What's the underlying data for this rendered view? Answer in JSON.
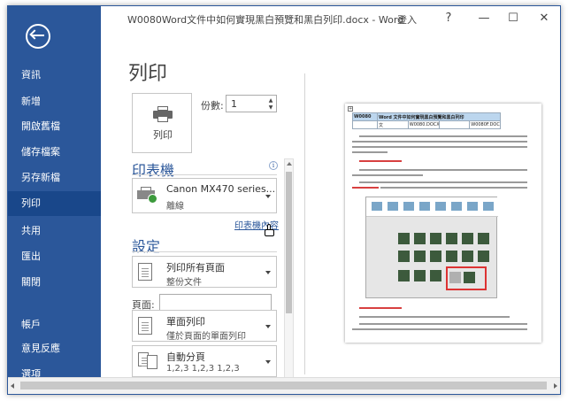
{
  "window": {
    "title": "W0080Word文件中如何實現黑白預覽和黑白列印.docx - Word",
    "login": "登入",
    "help": "?",
    "minimize": "—",
    "maximize": "☐",
    "close": "✕"
  },
  "sidebar": {
    "items": [
      {
        "label": "資訊"
      },
      {
        "label": "新增"
      },
      {
        "label": "開啟舊檔"
      },
      {
        "label": "儲存檔案"
      },
      {
        "label": "另存新檔"
      },
      {
        "label": "列印",
        "active": true
      },
      {
        "label": "共用"
      },
      {
        "label": "匯出"
      },
      {
        "label": "關閉"
      },
      {
        "label": "帳戶"
      },
      {
        "label": "意見反應"
      },
      {
        "label": "選項"
      }
    ]
  },
  "print": {
    "heading": "列印",
    "button_label": "列印",
    "copies_label": "份數:",
    "copies_value": "1"
  },
  "printer": {
    "section_title": "印表機",
    "name": "Canon MX470 series...",
    "status": "離線",
    "properties_link": "印表機內容"
  },
  "settings": {
    "section_title": "設定",
    "scope_main": "列印所有頁面",
    "scope_sub": "整份文件",
    "pages_label": "頁面:",
    "pages_value": "",
    "sides_main": "單面列印",
    "sides_sub": "僅於頁面的單面列印",
    "collate_main": "自動分頁",
    "collate_sub": "1,2,3    1,2,3    1,2,3"
  },
  "preview": {
    "table_header": [
      "W0080",
      "Word 文件中如何實現黑白預覽和黑白列印"
    ],
    "table_row": [
      "",
      "文",
      "W0080.DOCX",
      "",
      "W0080F.DOCX"
    ]
  },
  "colors": {
    "accent": "#2b579a",
    "sidebar_active": "#19478a"
  }
}
